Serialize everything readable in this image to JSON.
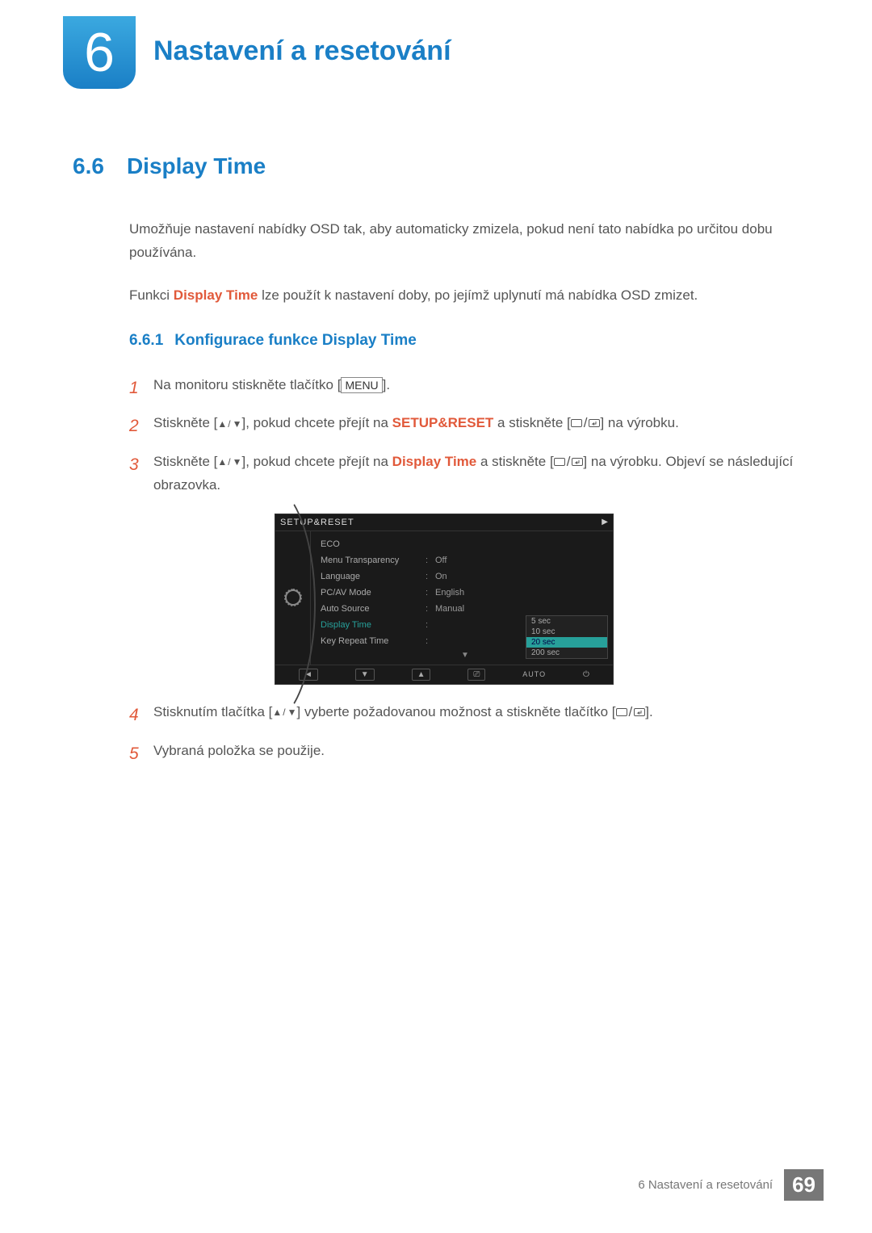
{
  "chapter": {
    "number": "6",
    "title": "Nastavení a resetování"
  },
  "section": {
    "number": "6.6",
    "title": "Display Time"
  },
  "intro1": "Umožňuje nastavení nabídky OSD tak, aby automaticky zmizela, pokud není tato nabídka po určitou dobu používána.",
  "intro2_a": "Funkci ",
  "intro2_hl": "Display Time",
  "intro2_b": " lze použít k nastavení doby, po jejímž uplynutí má nabídka OSD zmizet.",
  "subsection": {
    "number": "6.6.1",
    "title": "Konfigurace funkce Display Time"
  },
  "steps": {
    "s1_a": "Na monitoru stiskněte tlačítko [",
    "s1_menu": "MENU",
    "s1_b": "].",
    "s2_a": "Stiskněte [",
    "s2_b": "], pokud chcete přejít na ",
    "s2_hl": "SETUP&RESET",
    "s2_c": " a stiskněte [",
    "s2_d": "] na výrobku.",
    "s3_a": "Stiskněte [",
    "s3_b": "], pokud chcete přejít na ",
    "s3_hl": "Display Time",
    "s3_c": " a stiskněte [",
    "s3_d": "] na výrobku. Objeví se následující obrazovka.",
    "s4_a": "Stisknutím tlačítka [",
    "s4_b": "] vyberte požadovanou možnost a stiskněte tlačítko [",
    "s4_c": "].",
    "s5": "Vybraná položka se použije."
  },
  "osd": {
    "title": "SETUP&RESET",
    "rows": [
      {
        "label": "ECO",
        "val": ""
      },
      {
        "label": "Menu Transparency",
        "val": "Off"
      },
      {
        "label": "Language",
        "val": "On"
      },
      {
        "label": "PC/AV Mode",
        "val": "English"
      },
      {
        "label": "Auto Source",
        "val": "Manual"
      },
      {
        "label": "Display Time",
        "val": ""
      },
      {
        "label": "Key Repeat Time",
        "val": ""
      }
    ],
    "options": [
      "5 sec",
      "10 sec",
      "20 sec",
      "200 sec"
    ],
    "selected": "20 sec",
    "footer_auto": "AUTO"
  },
  "footer": {
    "text": "6 Nastavení a resetování",
    "page": "69"
  }
}
